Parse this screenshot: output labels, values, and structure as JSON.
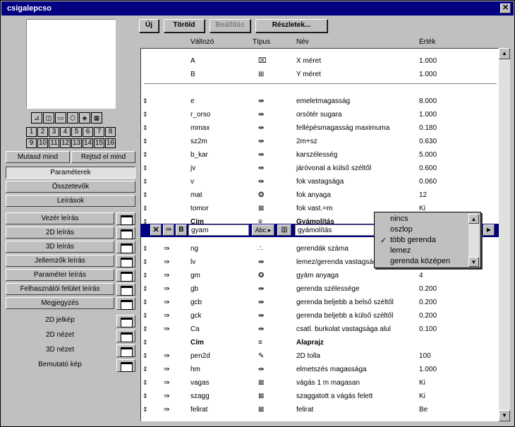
{
  "window": {
    "title": "csigalepcso",
    "close_glyph": "✕"
  },
  "toolbar": {
    "new": "Új",
    "delete": "Töröld",
    "settings": "Beállítás",
    "details": "Részletek..."
  },
  "grid_numbers": [
    "1",
    "2",
    "3",
    "4",
    "5",
    "6",
    "7",
    "8",
    "9",
    "10",
    "11",
    "12",
    "13",
    "14",
    "15",
    "16"
  ],
  "view_icons": [
    "floorplan-icon",
    "section-icon",
    "elevation-icon",
    "axonometric-icon",
    "3d-icon",
    "film-icon"
  ],
  "left": {
    "show_all": "Mutasd mind",
    "hide_all": "Rejtsd el mind",
    "tabs": [
      "Paraméterek",
      "Összetevők",
      "Leírások"
    ],
    "scripts": [
      "Vezér leírás",
      "2D leírás",
      "3D leírás",
      "Jellemzők leírás",
      "Paraméter leírás",
      "Felhasználói felület leírás",
      "Megjegyzés"
    ],
    "views": [
      "2D jelkép",
      "2D nézet",
      "3D nézet",
      "Bemutató kép"
    ]
  },
  "columns": {
    "variable": "Változó",
    "type": "Típus",
    "name": "Név",
    "value": "Érték"
  },
  "rows": [
    {
      "var": "A",
      "type": "xsize",
      "name": "X méret",
      "value": "1.000",
      "arrows": false,
      "indent": false
    },
    {
      "var": "B",
      "type": "ysize",
      "name": "Y méret",
      "value": "1.000",
      "arrows": false,
      "indent": false
    },
    {
      "var": "e",
      "type": "length",
      "name": "emeletmagasság",
      "value": "8.000",
      "arrows": true,
      "indent": false
    },
    {
      "var": "r_orso",
      "type": "length",
      "name": "orsótér sugara",
      "value": "1.000",
      "arrows": true,
      "indent": false
    },
    {
      "var": "mmax",
      "type": "length",
      "name": "fellépésmagasság maximuma",
      "value": "0.180",
      "arrows": true,
      "indent": false
    },
    {
      "var": "sz2m",
      "type": "length",
      "name": "2m+sz",
      "value": "0.630",
      "arrows": true,
      "indent": false
    },
    {
      "var": "b_kar",
      "type": "length",
      "name": "karszélesség",
      "value": "5.000",
      "arrows": true,
      "indent": false
    },
    {
      "var": "jv",
      "type": "length",
      "name": "járóvonal a külső széltől",
      "value": "0.600",
      "arrows": true,
      "indent": false
    },
    {
      "var": "v",
      "type": "length",
      "name": "fok vastagsága",
      "value": "0.060",
      "arrows": true,
      "indent": false
    },
    {
      "var": "mat",
      "type": "material",
      "name": "fok anyaga",
      "value": "12",
      "arrows": true,
      "indent": false
    },
    {
      "var": "tomor",
      "type": "bool",
      "name": "fok vast.=m",
      "value": "Ki",
      "arrows": true,
      "indent": false
    },
    {
      "var": "Cím",
      "type": "title",
      "name": "Gyámolítás",
      "value": "",
      "arrows": true,
      "indent": false,
      "bold": true
    },
    {
      "var": "gyam",
      "type": "abc",
      "name": "gyámolítás",
      "value": "",
      "arrows": true,
      "indent": true,
      "selected": true
    },
    {
      "var": "ng",
      "type": "integer",
      "name": "gerendák száma",
      "value": "",
      "arrows": true,
      "indent": true
    },
    {
      "var": "lv",
      "type": "length",
      "name": "lemez/gerenda vastagsága",
      "value": "",
      "arrows": true,
      "indent": true
    },
    {
      "var": "gm",
      "type": "material",
      "name": "gyám anyaga",
      "value": "4",
      "arrows": true,
      "indent": true
    },
    {
      "var": "gb",
      "type": "length",
      "name": "gerenda szélessége",
      "value": "0.200",
      "arrows": true,
      "indent": true
    },
    {
      "var": "gcb",
      "type": "length",
      "name": "gerenda beljebb a belső széltől",
      "value": "0.200",
      "arrows": true,
      "indent": true
    },
    {
      "var": "gck",
      "type": "length",
      "name": "gerenda beljebb a külső széltől",
      "value": "0.200",
      "arrows": true,
      "indent": true
    },
    {
      "var": "Ca",
      "type": "length",
      "name": "csatl. burkolat vastagsága alul",
      "value": "0.100",
      "arrows": true,
      "indent": true
    },
    {
      "var": "Cím",
      "type": "title",
      "name": "Alaprajz",
      "value": "",
      "arrows": true,
      "indent": false,
      "bold": true
    },
    {
      "var": "pen2d",
      "type": "pen",
      "name": "2D tolla",
      "value": "100",
      "arrows": true,
      "indent": true
    },
    {
      "var": "hm",
      "type": "length",
      "name": "elmetszés magassága",
      "value": "1.000",
      "arrows": true,
      "indent": true
    },
    {
      "var": "vagas",
      "type": "bool",
      "name": "vágás 1 m magasan",
      "value": "Ki",
      "arrows": true,
      "indent": true
    },
    {
      "var": "szagg",
      "type": "bool",
      "name": "szaggatott a vágás felett",
      "value": "Ki",
      "arrows": true,
      "indent": true
    },
    {
      "var": "felirat",
      "type": "bool",
      "name": "felirat",
      "value": "Be",
      "arrows": true,
      "indent": true
    }
  ],
  "selected_row": {
    "x_glyph": "✕",
    "b_label": "B",
    "abc_label": "Abc"
  },
  "popup": {
    "items": [
      "nincs",
      "oszlop",
      "több gerenda",
      "lemez",
      "gerenda középen"
    ],
    "checked_index": 2,
    "check_glyph": "✓"
  }
}
